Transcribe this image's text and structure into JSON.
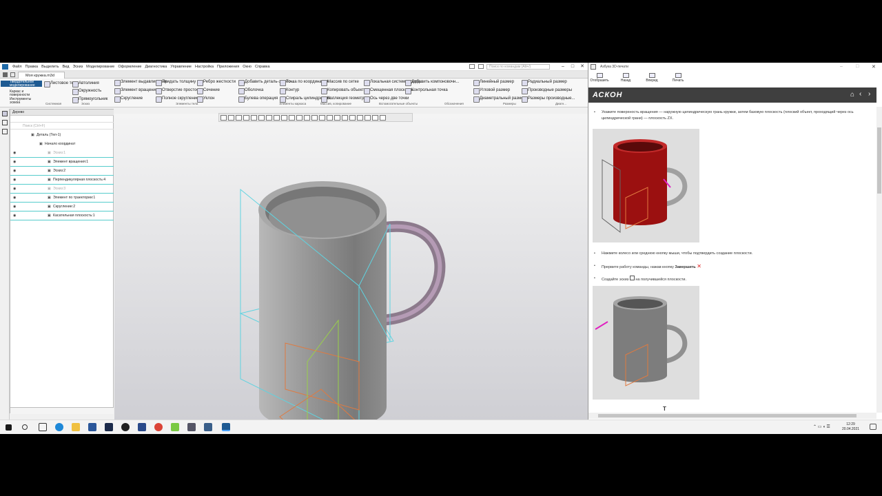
{
  "kompas": {
    "menu": [
      "Файл",
      "Правка",
      "Выделить",
      "Вид",
      "Эскиз",
      "Моделирование",
      "Оформление",
      "Диагностика",
      "Управление",
      "Настройка",
      "Приложения",
      "Окно",
      "Справка"
    ],
    "command_search_placeholder": "Поиск по командам (Alt+/)",
    "document_tab": "Моя кружка.m3d",
    "ribbon_tabs": [
      "Твердотельное моделирование",
      "Каркас и поверхности",
      "Инструменты эскиза"
    ],
    "ribbon": {
      "system": [
        "Листовое тело"
      ],
      "sketch": [
        "Автолиния",
        "Окружность",
        "Прямоугольник"
      ],
      "body": [
        "Элемент выдавливания",
        "Элемент вращения",
        "Скругление",
        "Придать толщину",
        "Отверстие простое",
        "Полное скругление",
        "Ребро жесткости",
        "Сечение",
        "Уклон",
        "Добавить деталь-загото...",
        "Оболочка",
        "Булева операция"
      ],
      "frame": [
        "Точка по координатам",
        "Контур",
        "Спираль цилиндрическ..."
      ],
      "array": [
        "Массив по сетке",
        "Копировать объекты",
        "Коллекция геометрии"
      ],
      "aux": [
        "Локальная система коорд...",
        "Смещенная плоскость",
        "Ось через две точки",
        "Добавить компоновочн...",
        "Контрольная точка"
      ],
      "dims": [
        "Линейный размер",
        "Угловой размер",
        "Диаметральный размер",
        "Радиальный размер",
        "Производные размеры",
        "Размеры производные..."
      ],
      "group_labels": [
        "Системная",
        "Эскиз",
        "Элементы тела",
        "Элементы каркаса",
        "Массив, копирование",
        "Вспомогательные объекты",
        "Обозначения",
        "Размеры",
        "Диагн..."
      ]
    },
    "tree": {
      "header": "Дерево",
      "search_placeholder": "Поиск (Ctrl+F)",
      "nodes": [
        {
          "label": "Деталь (Тел-1)",
          "dim": false,
          "indent": 1
        },
        {
          "label": "Начало координат",
          "dim": false,
          "indent": 2
        },
        {
          "label": "Эскиз:1",
          "dim": true,
          "indent": 3
        },
        {
          "label": "Элемент вращения:1",
          "dim": false,
          "indent": 3
        },
        {
          "label": "Эскиз:2",
          "dim": false,
          "indent": 3
        },
        {
          "label": "Перпендикулярная плоскость:4",
          "dim": false,
          "indent": 3
        },
        {
          "label": "Эскиз:3",
          "dim": true,
          "indent": 3
        },
        {
          "label": "Элемент по траектории:1",
          "dim": false,
          "indent": 3
        },
        {
          "label": "Скругление:2",
          "dim": false,
          "indent": 3
        },
        {
          "label": "Касательная плоскость:1",
          "dim": false,
          "indent": 3
        }
      ]
    }
  },
  "help": {
    "title": "Азбука 3D-печати",
    "tools": [
      "Отобразить",
      "Назад",
      "Вперед",
      "Печать"
    ],
    "brand": "АСКОН",
    "steps": [
      "Укажите поверхность вращения — наружную цилиндрическую грань кружки, затем базовую плоскость (плоский объект, проходящий через ось цилиндрической грани) — плоскость ZX.",
      "Нажмите колесо или среднюю кнопку мыши, чтобы подтвердить создание плоскости.",
      "Прервите работу команды, нажав кнопку",
      "Создайте эскиз",
      "на получившейся плоскости."
    ],
    "interrupt_label": "Завершить"
  },
  "taskbar": {
    "time": "12:29",
    "date": "20.04.2021"
  },
  "colors": {
    "ribbon_active": "#1e5a92",
    "brand_orange": "#e54b1f",
    "brand_bar": "#3f3f3f",
    "mug_gray": "#8f8f8f",
    "mug_red": "#9b1010",
    "plane_cyan": "#5fd3e0",
    "plane_orange": "#e07a40"
  }
}
